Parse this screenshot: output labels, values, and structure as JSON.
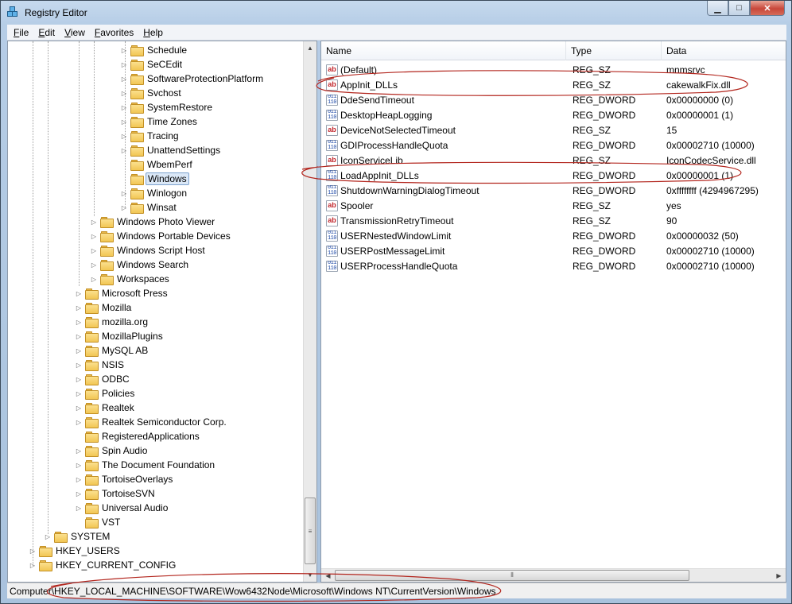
{
  "window": {
    "title": "Registry Editor",
    "min_glyph": "▁",
    "max_glyph": "□",
    "close_glyph": "✕"
  },
  "menu": [
    {
      "label": "File"
    },
    {
      "label": "Edit"
    },
    {
      "label": "View"
    },
    {
      "label": "Favorites"
    },
    {
      "label": "Help"
    }
  ],
  "tree": {
    "items": [
      {
        "label": "Schedule",
        "has_children": true
      },
      {
        "label": "SeCEdit",
        "has_children": true
      },
      {
        "label": "SoftwareProtectionPlatform",
        "has_children": true
      },
      {
        "label": "Svchost",
        "has_children": true
      },
      {
        "label": "SystemRestore",
        "has_children": true
      },
      {
        "label": "Time Zones",
        "has_children": true
      },
      {
        "label": "Tracing",
        "has_children": true
      },
      {
        "label": "UnattendSettings",
        "has_children": true
      },
      {
        "label": "WbemPerf",
        "has_children": false
      },
      {
        "label": "Windows",
        "has_children": false,
        "selected": true
      },
      {
        "label": "Winlogon",
        "has_children": true
      },
      {
        "label": "Winsat",
        "has_children": true
      },
      {
        "label": "Windows Photo Viewer",
        "has_children": true
      },
      {
        "label": "Windows Portable Devices",
        "has_children": true
      },
      {
        "label": "Windows Script Host",
        "has_children": true
      },
      {
        "label": "Windows Search",
        "has_children": true
      },
      {
        "label": "Workspaces",
        "has_children": true
      },
      {
        "label": "Microsoft Press",
        "has_children": true
      },
      {
        "label": "Mozilla",
        "has_children": true
      },
      {
        "label": "mozilla.org",
        "has_children": true
      },
      {
        "label": "MozillaPlugins",
        "has_children": true
      },
      {
        "label": "MySQL AB",
        "has_children": true
      },
      {
        "label": "NSIS",
        "has_children": true
      },
      {
        "label": "ODBC",
        "has_children": true
      },
      {
        "label": "Policies",
        "has_children": true
      },
      {
        "label": "Realtek",
        "has_children": true
      },
      {
        "label": "Realtek Semiconductor Corp.",
        "has_children": true
      },
      {
        "label": "RegisteredApplications",
        "has_children": false
      },
      {
        "label": "Spin Audio",
        "has_children": true
      },
      {
        "label": "The Document Foundation",
        "has_children": true
      },
      {
        "label": "TortoiseOverlays",
        "has_children": true
      },
      {
        "label": "TortoiseSVN",
        "has_children": true
      },
      {
        "label": "Universal Audio",
        "has_children": true
      },
      {
        "label": "VST",
        "has_children": false
      },
      {
        "label": "SYSTEM",
        "has_children": true
      },
      {
        "label": "HKEY_USERS",
        "has_children": true
      },
      {
        "label": "HKEY_CURRENT_CONFIG",
        "has_children": true
      }
    ]
  },
  "list": {
    "columns": [
      "Name",
      "Type",
      "Data"
    ],
    "rows": [
      {
        "name": "(Default)",
        "type": "REG_SZ",
        "data": "mnmsrvc",
        "icon": "string-value-icon"
      },
      {
        "name": "AppInit_DLLs",
        "type": "REG_SZ",
        "data": "cakewalkFix.dll",
        "icon": "string-value-icon"
      },
      {
        "name": "DdeSendTimeout",
        "type": "REG_DWORD",
        "data": "0x00000000 (0)",
        "icon": "binary-value-icon"
      },
      {
        "name": "DesktopHeapLogging",
        "type": "REG_DWORD",
        "data": "0x00000001 (1)",
        "icon": "binary-value-icon"
      },
      {
        "name": "DeviceNotSelectedTimeout",
        "type": "REG_SZ",
        "data": "15",
        "icon": "string-value-icon"
      },
      {
        "name": "GDIProcessHandleQuota",
        "type": "REG_DWORD",
        "data": "0x00002710 (10000)",
        "icon": "binary-value-icon"
      },
      {
        "name": "IconServiceLib",
        "type": "REG_SZ",
        "data": "IconCodecService.dll",
        "icon": "string-value-icon"
      },
      {
        "name": "LoadAppInit_DLLs",
        "type": "REG_DWORD",
        "data": "0x00000001 (1)",
        "icon": "binary-value-icon"
      },
      {
        "name": "ShutdownWarningDialogTimeout",
        "type": "REG_DWORD",
        "data": "0xffffffff (4294967295)",
        "icon": "binary-value-icon"
      },
      {
        "name": "Spooler",
        "type": "REG_SZ",
        "data": "yes",
        "icon": "string-value-icon"
      },
      {
        "name": "TransmissionRetryTimeout",
        "type": "REG_SZ",
        "data": "90",
        "icon": "string-value-icon"
      },
      {
        "name": "USERNestedWindowLimit",
        "type": "REG_DWORD",
        "data": "0x00000032 (50)",
        "icon": "binary-value-icon"
      },
      {
        "name": "USERPostMessageLimit",
        "type": "REG_DWORD",
        "data": "0x00002710 (10000)",
        "icon": "binary-value-icon"
      },
      {
        "name": "USERProcessHandleQuota",
        "type": "REG_DWORD",
        "data": "0x00002710 (10000)",
        "icon": "binary-value-icon"
      }
    ]
  },
  "status": {
    "path": "Computer\\HKEY_LOCAL_MACHINE\\SOFTWARE\\Wow6432Node\\Microsoft\\Windows NT\\CurrentVersion\\Windows"
  },
  "icons": {
    "string_glyph": "ab",
    "dword_glyph": "011\n110",
    "expand_glyph": "▷",
    "scroll_up": "▲",
    "scroll_down": "▼",
    "scroll_left": "◀",
    "scroll_right": "▶",
    "grip": "≡",
    "grip_h": "⦀"
  },
  "colors": {
    "annotation": "#b3261e",
    "selection": "#dbe8f7"
  }
}
